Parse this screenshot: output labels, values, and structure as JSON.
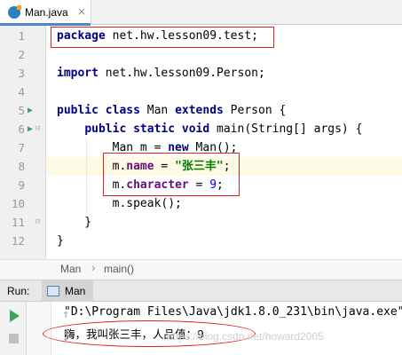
{
  "tab": {
    "file_name": "Man.java",
    "close_glyph": "×",
    "file_icon": "java-class-icon"
  },
  "editor": {
    "lines": [
      {
        "n": "1",
        "text": "package net.hw.lesson09.test;"
      },
      {
        "n": "2",
        "text": ""
      },
      {
        "n": "3",
        "text": "import net.hw.lesson09.Person;"
      },
      {
        "n": "4",
        "text": ""
      },
      {
        "n": "5",
        "text": "public class Man extends Person {"
      },
      {
        "n": "6",
        "text": "    public static void main(String[] args) {"
      },
      {
        "n": "7",
        "text": "        Man m = new Man();"
      },
      {
        "n": "8",
        "text": "        m.name = \"张三丰\";"
      },
      {
        "n": "9",
        "text": "        m.character = 9;"
      },
      {
        "n": "10",
        "text": "        m.speak();"
      },
      {
        "n": "11",
        "text": "    }"
      },
      {
        "n": "12",
        "text": "}"
      }
    ],
    "current_line": "8"
  },
  "breadcrumb": {
    "items": [
      "Man",
      "main()"
    ],
    "separator": "›"
  },
  "run": {
    "title": "Run:",
    "tab_label": "Man",
    "console": [
      "\"D:\\Program Files\\Java\\jdk1.8.0_231\\bin\\java.exe\"",
      "嗨，我叫张三丰，人品值：9"
    ]
  },
  "watermark": "https://blog.csdn.net/howard2005",
  "colors": {
    "keyword": "#000080",
    "field": "#660e7a",
    "string": "#008000",
    "number": "#0000ff",
    "highlight_box": "#e0201a",
    "current_line": "#fffae3"
  }
}
